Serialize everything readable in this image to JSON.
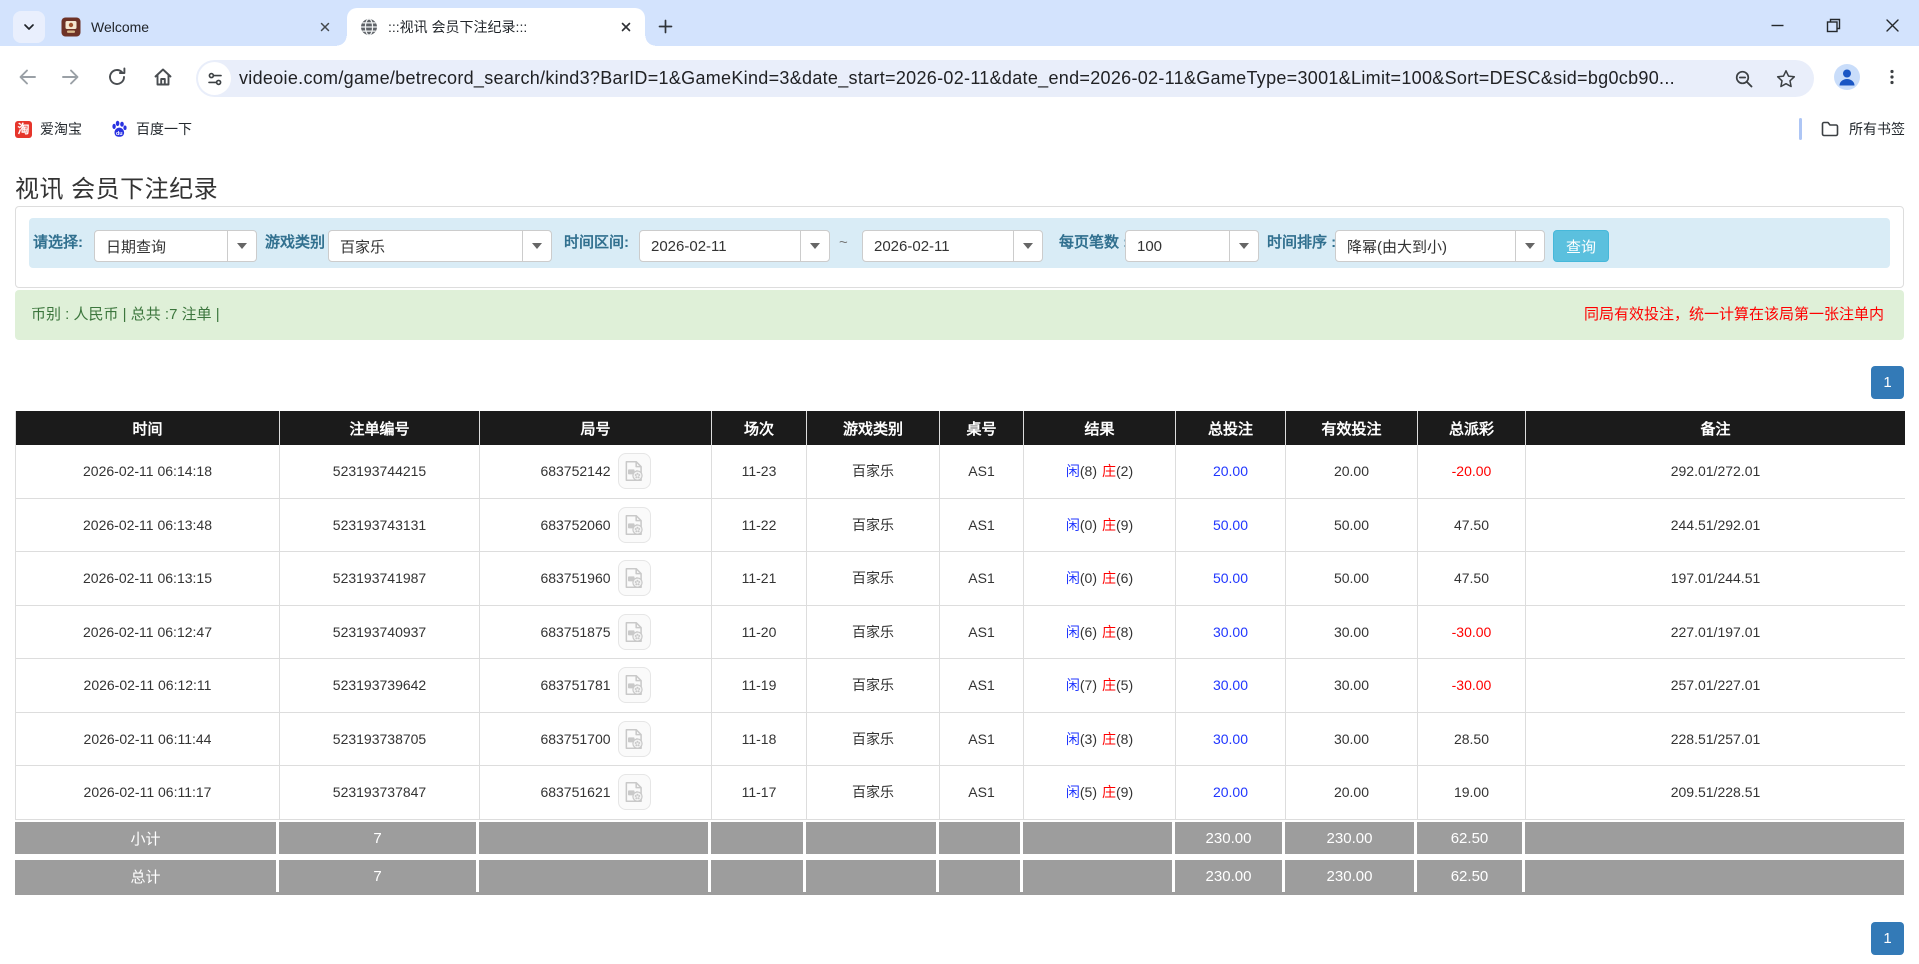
{
  "browser": {
    "tab_search_icon": "chevron-down-icon",
    "tabs": [
      {
        "title": "Welcome",
        "favicon": "site-favicon",
        "close_icon": "close-icon"
      },
      {
        "title": ":::视讯 会员下注纪录:::",
        "favicon": "globe-icon",
        "close_icon": "close-icon",
        "active": true
      }
    ],
    "new_tab_icon": "plus-icon",
    "window_controls": [
      "minimize-icon",
      "restore-icon",
      "close-icon"
    ],
    "nav_icons": [
      "back-icon",
      "forward-icon",
      "reload-icon",
      "home-icon"
    ],
    "url": "videoie.com/game/betrecord_search/kind3?BarID=1&GameKind=3&date_start=2026-02-11&date_end=2026-02-11&GameType=3001&Limit=100&Sort=DESC&sid=bg0cb90...",
    "omnibox_icons": [
      "site-settings-icon",
      "zoom-icon",
      "star-icon"
    ],
    "profile_icon": "avatar",
    "menu_icon": "kebab-menu-icon",
    "bookmarks": [
      {
        "label": "爱淘宝",
        "icon": "taobao-icon"
      },
      {
        "label": "百度一下",
        "icon": "baidu-icon"
      }
    ],
    "all_bookmarks_label": "所有书签",
    "all_bookmarks_icon": "folder-icon"
  },
  "page": {
    "title": "视讯 会员下注纪录",
    "filters": {
      "select_label": "请选择:",
      "select_value": "日期查询",
      "game_type_label": "游戏类别",
      "game_type_value": "百家乐",
      "date_range_label": "时间区间:",
      "date_start": "2026-02-11",
      "date_separator": "~",
      "date_end": "2026-02-11",
      "page_size_label": "每页笔数 :",
      "page_size_value": "100",
      "sort_label": "时间排序 :",
      "sort_value": "降幂(由大到小)",
      "search_button": "查询"
    },
    "summary": {
      "left": "币别 : 人民币 | 总共 :7 注单 |",
      "right_note": "同局有效投注，统一计算在该局第一张注单内"
    },
    "pagination": {
      "page": "1"
    },
    "table": {
      "headers": [
        "时间",
        "注单编号",
        "局号",
        "场次",
        "游戏类别",
        "桌号",
        "结果",
        "总投注",
        "有效投注",
        "总派彩",
        "备注"
      ],
      "video_icon": "video-file-icon",
      "rows": [
        {
          "time": "2026-02-11 06:14:18",
          "bet_id": "523193744215",
          "round_id": "683752142",
          "session": "11-23",
          "game": "百家乐",
          "table_no": "AS1",
          "player": "闲",
          "player_score": "(8)",
          "banker": "庄",
          "banker_score": "(2)",
          "total_bet": "20.00",
          "valid_bet": "20.00",
          "payout": "-20.00",
          "remark": "292.01/272.01"
        },
        {
          "time": "2026-02-11 06:13:48",
          "bet_id": "523193743131",
          "round_id": "683752060",
          "session": "11-22",
          "game": "百家乐",
          "table_no": "AS1",
          "player": "闲",
          "player_score": "(0)",
          "banker": "庄",
          "banker_score": "(9)",
          "total_bet": "50.00",
          "valid_bet": "50.00",
          "payout": "47.50",
          "remark": "244.51/292.01"
        },
        {
          "time": "2026-02-11 06:13:15",
          "bet_id": "523193741987",
          "round_id": "683751960",
          "session": "11-21",
          "game": "百家乐",
          "table_no": "AS1",
          "player": "闲",
          "player_score": "(0)",
          "banker": "庄",
          "banker_score": "(6)",
          "total_bet": "50.00",
          "valid_bet": "50.00",
          "payout": "47.50",
          "remark": "197.01/244.51"
        },
        {
          "time": "2026-02-11 06:12:47",
          "bet_id": "523193740937",
          "round_id": "683751875",
          "session": "11-20",
          "game": "百家乐",
          "table_no": "AS1",
          "player": "闲",
          "player_score": "(6)",
          "banker": "庄",
          "banker_score": "(8)",
          "total_bet": "30.00",
          "valid_bet": "30.00",
          "payout": "-30.00",
          "remark": "227.01/197.01"
        },
        {
          "time": "2026-02-11 06:12:11",
          "bet_id": "523193739642",
          "round_id": "683751781",
          "session": "11-19",
          "game": "百家乐",
          "table_no": "AS1",
          "player": "闲",
          "player_score": "(7)",
          "banker": "庄",
          "banker_score": "(5)",
          "total_bet": "30.00",
          "valid_bet": "30.00",
          "payout": "-30.00",
          "remark": "257.01/227.01"
        },
        {
          "time": "2026-02-11 06:11:44",
          "bet_id": "523193738705",
          "round_id": "683751700",
          "session": "11-18",
          "game": "百家乐",
          "table_no": "AS1",
          "player": "闲",
          "player_score": "(3)",
          "banker": "庄",
          "banker_score": "(8)",
          "total_bet": "30.00",
          "valid_bet": "30.00",
          "payout": "28.50",
          "remark": "228.51/257.01"
        },
        {
          "time": "2026-02-11 06:11:17",
          "bet_id": "523193737847",
          "round_id": "683751621",
          "session": "11-17",
          "game": "百家乐",
          "table_no": "AS1",
          "player": "闲",
          "player_score": "(5)",
          "banker": "庄",
          "banker_score": "(9)",
          "total_bet": "20.00",
          "valid_bet": "20.00",
          "payout": "19.00",
          "remark": "209.51/228.51"
        }
      ],
      "subtotal": {
        "label": "小计",
        "count": "7",
        "total_bet": "230.00",
        "valid_bet": "230.00",
        "payout": "62.50"
      },
      "total": {
        "label": "总计",
        "count": "7",
        "total_bet": "230.00",
        "valid_bet": "230.00",
        "payout": "62.50"
      }
    }
  },
  "colors": {
    "tab_strip": "#d3e3fd",
    "accent_pager": "#337ab7",
    "search_button": "#5bc0de",
    "filter_bar_bg": "#d9ecf6",
    "filter_label": "#31708f",
    "summary_bg": "#dff0d8",
    "summary_text": "#3c763d",
    "note_red": "#ff0000",
    "table_header_bg": "#1b1b1b",
    "value_blue": "#2036ff",
    "negative_red": "#ff0000",
    "summary_row_gray": "#9d9d9d"
  }
}
